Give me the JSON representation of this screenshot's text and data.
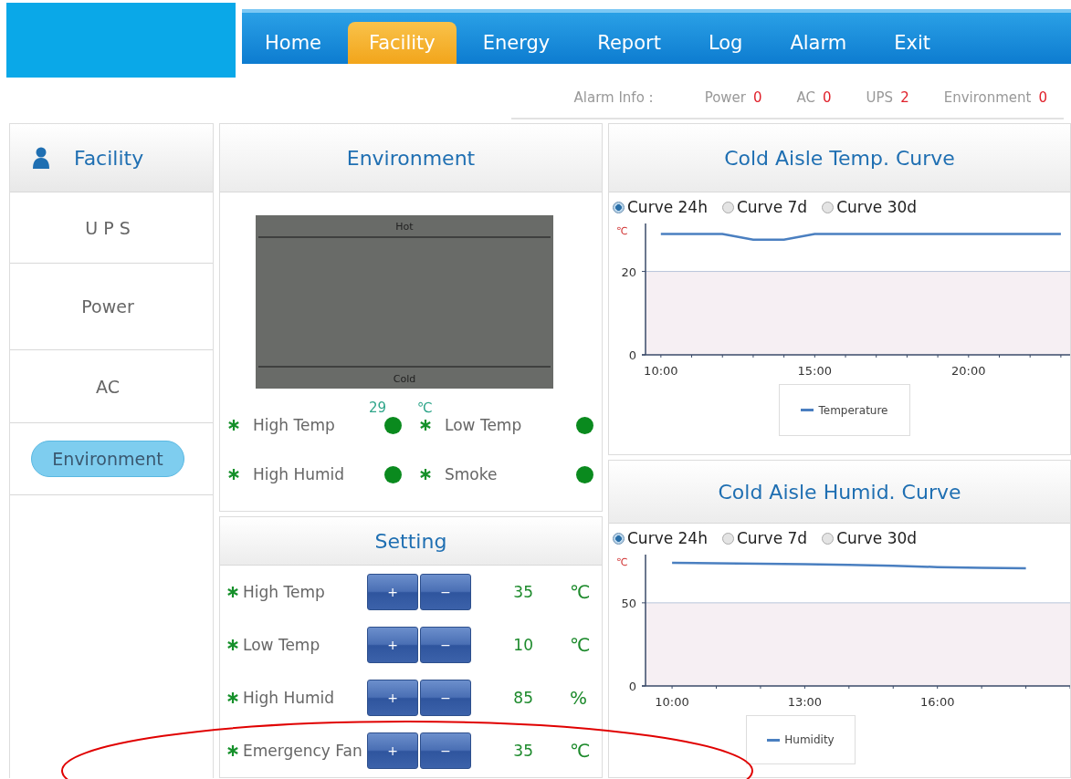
{
  "nav": {
    "tabs": [
      {
        "label": "Home",
        "selected": false
      },
      {
        "label": "Facility",
        "selected": true
      },
      {
        "label": "Energy",
        "selected": false
      },
      {
        "label": "Report",
        "selected": false
      },
      {
        "label": "Log",
        "selected": false
      },
      {
        "label": "Alarm",
        "selected": false
      },
      {
        "label": "Exit",
        "selected": false
      }
    ]
  },
  "alarm_info": {
    "label": "Alarm Info :",
    "items": [
      {
        "name": "Power",
        "count": "0"
      },
      {
        "name": "AC",
        "count": "0"
      },
      {
        "name": "UPS",
        "count": "2"
      },
      {
        "name": "Environment",
        "count": "0"
      }
    ]
  },
  "sidebar": {
    "items": [
      {
        "kind": "header",
        "label": "Facility",
        "selected": false
      },
      {
        "kind": "item",
        "label": "U P S",
        "selected": false
      },
      {
        "kind": "item",
        "label": "Power",
        "selected": false
      },
      {
        "kind": "item",
        "label": "AC",
        "selected": false
      },
      {
        "kind": "item",
        "label": "Environment",
        "selected": true
      }
    ]
  },
  "environment": {
    "title": "Environment",
    "diagram": {
      "top_label": "Hot",
      "bottom_label": "Cold"
    },
    "reading": "29",
    "unit": "℃",
    "statuses": [
      {
        "label": "High Temp",
        "color": "#0a8a1e"
      },
      {
        "label": "Low Temp",
        "color": "#0a8a1e"
      },
      {
        "label": "High Humid",
        "color": "#0a8a1e"
      },
      {
        "label": "Smoke",
        "color": "#0a8a1e"
      }
    ]
  },
  "setting": {
    "title": "Setting",
    "rows": [
      {
        "label": "High Temp",
        "plus": "+",
        "minus": "−",
        "value": "35",
        "unit": "℃"
      },
      {
        "label": "Low Temp",
        "plus": "+",
        "minus": "−",
        "value": "10",
        "unit": "℃"
      },
      {
        "label": "High Humid",
        "plus": "+",
        "minus": "−",
        "value": "85",
        "unit": "%"
      },
      {
        "label": "Emergency Fan",
        "plus": "+",
        "minus": "−",
        "value": "35",
        "unit": "℃"
      }
    ]
  },
  "curves": [
    {
      "title": "Cold Aisle Temp. Curve",
      "options": [
        {
          "label": "Curve 24h",
          "selected": true
        },
        {
          "label": "Curve 7d",
          "selected": false
        },
        {
          "label": "Curve 30d",
          "selected": false
        }
      ],
      "chart_data": {
        "type": "line",
        "ylabel": "℃",
        "xlim": [
          9.5,
          23.3
        ],
        "ylim": [
          0,
          31.5
        ],
        "xticks": [
          {
            "value": 10,
            "label": "10:00"
          },
          {
            "value": 15,
            "label": "15:00"
          },
          {
            "value": 20,
            "label": "20:00"
          }
        ],
        "yticks": [
          0,
          20
        ],
        "x": [
          10,
          11,
          12,
          13,
          14,
          15,
          16,
          17,
          18,
          19,
          20,
          21,
          22,
          23
        ],
        "series": [
          {
            "name": "Temperature",
            "color": "#4a7fc0",
            "values": [
              29,
              29,
              29,
              27.6,
              27.6,
              29,
              29,
              29,
              29,
              29,
              29,
              29,
              29,
              29
            ]
          }
        ]
      }
    },
    {
      "title": "Cold Aisle Humid. Curve",
      "options": [
        {
          "label": "Curve 24h",
          "selected": true
        },
        {
          "label": "Curve 7d",
          "selected": false
        },
        {
          "label": "Curve 30d",
          "selected": false
        }
      ],
      "chart_data": {
        "type": "line",
        "ylabel": "℃",
        "xlim": [
          9.4,
          19
        ],
        "ylim": [
          0,
          79
        ],
        "xticks": [
          {
            "value": 10,
            "label": "10:00"
          },
          {
            "value": 13,
            "label": "13:00"
          },
          {
            "value": 16,
            "label": "16:00"
          }
        ],
        "yticks": [
          0,
          50
        ],
        "x": [
          10,
          11,
          12,
          13,
          14,
          15,
          16,
          17,
          18
        ],
        "series": [
          {
            "name": "Humidity",
            "color": "#4a7fc0",
            "values": [
              74,
              73.8,
              73.5,
              73.2,
              72.8,
              72.3,
              71.5,
              71,
              70.8
            ]
          }
        ]
      }
    }
  ],
  "annotation": {
    "kind": "ellipse",
    "color": "#e00000"
  }
}
